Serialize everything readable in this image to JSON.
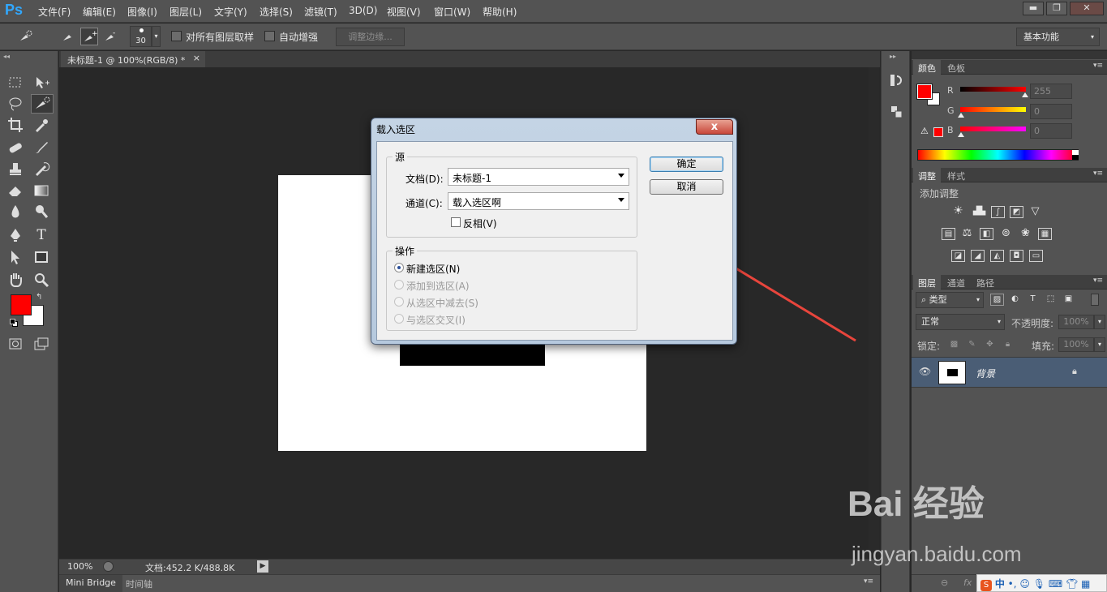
{
  "app": {
    "logo": "Ps"
  },
  "menu": [
    "文件(F)",
    "编辑(E)",
    "图像(I)",
    "图层(L)",
    "文字(Y)",
    "选择(S)",
    "滤镜(T)",
    "3D(D)",
    "视图(V)",
    "窗口(W)",
    "帮助(H)"
  ],
  "window_controls": {
    "minimize": "▬",
    "restore": "❐",
    "close": "✕"
  },
  "options": {
    "brush_size": "30",
    "sample_all_layers": "对所有图层取样",
    "auto_enhance": "自动增强",
    "refine_edge": "调整边缘...",
    "workspace": "基本功能"
  },
  "document": {
    "tab_title": "未标题-1 @ 100%(RGB/8) *",
    "close_glyph": "×",
    "zoom": "100%",
    "doc_size": "文档:452.2 K/488.8K"
  },
  "bottom_tabs": [
    "Mini Bridge",
    "时间轴"
  ],
  "colors": {
    "foreground": "#ff0000",
    "background": "#ffffff"
  },
  "color_panel": {
    "tabs": [
      "颜色",
      "色板"
    ],
    "channels": [
      {
        "label": "R",
        "value": "255"
      },
      {
        "label": "G",
        "value": "0"
      },
      {
        "label": "B",
        "value": "0"
      }
    ]
  },
  "adjust_panel": {
    "tabs": [
      "调整",
      "样式"
    ],
    "title": "添加调整"
  },
  "layers_panel": {
    "tabs": [
      "图层",
      "通道",
      "路径"
    ],
    "filter_kind": "类型",
    "blend_mode": "正常",
    "opacity_label": "不透明度:",
    "opacity": "100%",
    "lock_label": "锁定:",
    "fill_label": "填充:",
    "fill": "100%",
    "layer_name": "背景"
  },
  "dialog": {
    "title": "载入选区",
    "close": "x",
    "source_group": "源",
    "document_label": "文档(D):",
    "document_value": "未标题-1",
    "channel_label": "通道(C):",
    "channel_value": "载入选区啊",
    "invert_label": "反相(V)",
    "operation_group": "操作",
    "operations": [
      "新建选区(N)",
      "添加到选区(A)",
      "从选区中减去(S)",
      "与选区交叉(I)"
    ],
    "ok": "确定",
    "cancel": "取消"
  },
  "watermark": {
    "brand": "Bai 经验",
    "url": "jingyan.baidu.com"
  },
  "ime": {
    "label": "中"
  }
}
